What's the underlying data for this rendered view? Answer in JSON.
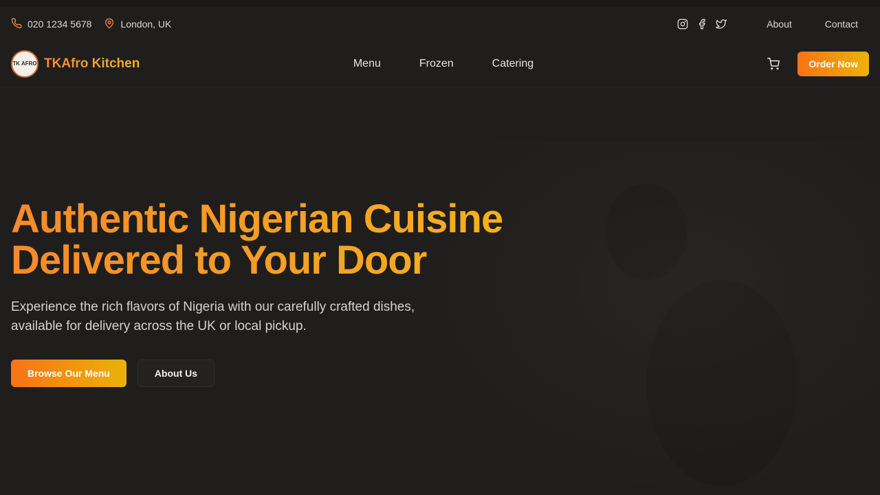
{
  "topbar": {
    "phone": "020 1234 5678",
    "location": "London, UK",
    "socials": [
      "instagram-icon",
      "facebook-icon",
      "twitter-icon"
    ],
    "links": {
      "about": "About",
      "contact": "Contact"
    }
  },
  "navbar": {
    "logo_text": "TK AFRO",
    "brand": "TKAfro Kitchen",
    "items": [
      "Menu",
      "Frozen",
      "Catering"
    ],
    "order_button": "Order Now"
  },
  "hero": {
    "title_line1": "Authentic Nigerian Cuisine",
    "title_line2": "Delivered to Your Door",
    "subtitle": "Experience the rich flavors of Nigeria with our carefully crafted dishes, available for delivery across the UK or local pickup.",
    "primary_button": "Browse Our Menu",
    "secondary_button": "About Us"
  },
  "colors": {
    "accent_start": "#f97316",
    "accent_end": "#eab308",
    "background": "#1f1e1d"
  }
}
